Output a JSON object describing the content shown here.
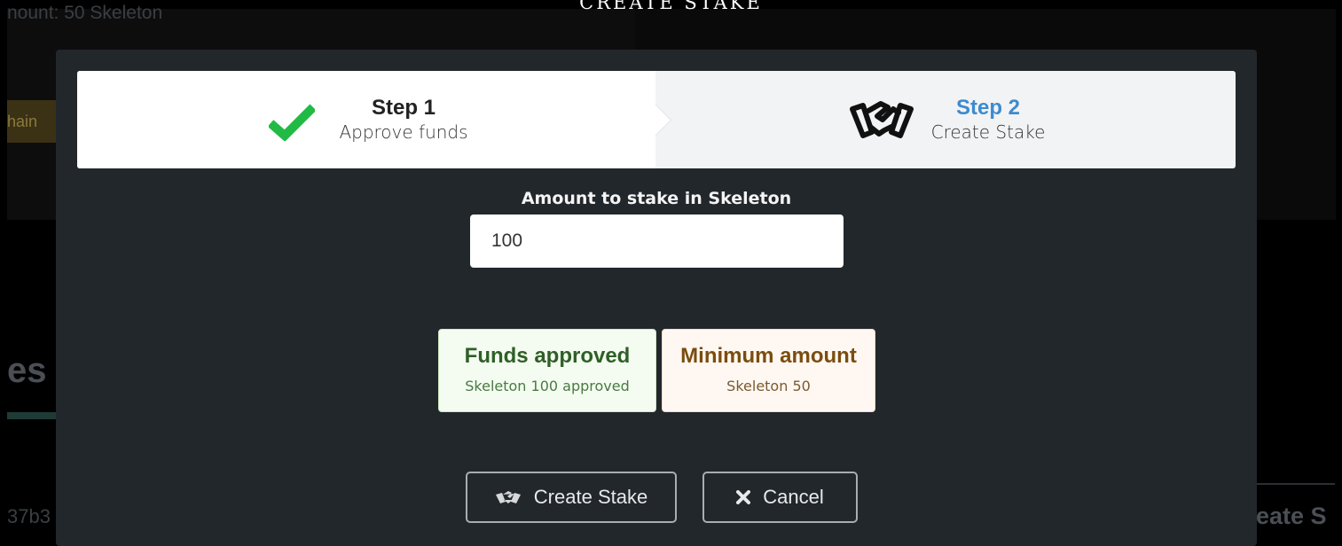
{
  "background": {
    "amount_text": "nount: 50 Skeleton",
    "chain_button": "hain",
    "heading_fragment": "es",
    "hash_fragment": "37b3",
    "create_fragment": "eate S"
  },
  "modal": {
    "title": "CREATE STAKE",
    "steps": [
      {
        "title": "Step 1",
        "description": "Approve funds",
        "icon": "check-icon",
        "status": "completed"
      },
      {
        "title": "Step 2",
        "description": "Create Stake",
        "icon": "handshake-icon",
        "status": "active"
      }
    ],
    "amount": {
      "label": "Amount to stake in Skeleton",
      "value": "100"
    },
    "stats": {
      "approved": {
        "title": "Funds approved",
        "value": "Skeleton 100 approved"
      },
      "minimum": {
        "title": "Minimum amount",
        "value": "Skeleton 50"
      }
    },
    "buttons": {
      "create": {
        "label": "Create Stake",
        "icon": "handshake-icon"
      },
      "cancel": {
        "label": "Cancel",
        "icon": "close-icon"
      }
    }
  },
  "colors": {
    "overlay": "#000000",
    "modal_bg": "#22272c",
    "step_active": "#3d8bd0",
    "check_green": "#21ba45",
    "approved_text": "#2f5f27",
    "minimum_text": "#7a4d0f"
  }
}
